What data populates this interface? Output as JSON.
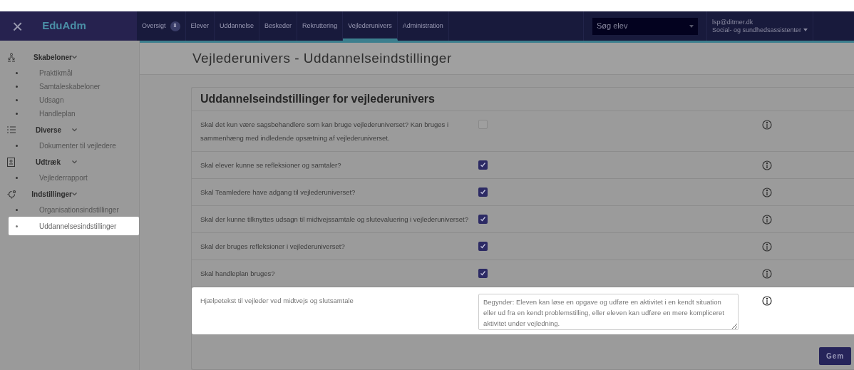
{
  "app": {
    "title": "EduAdm",
    "close_glyph": "×"
  },
  "nav_tabs": [
    {
      "label": "Oversigt",
      "badge": "8",
      "selected": false
    },
    {
      "label": "Elever",
      "selected": false
    },
    {
      "label": "Uddannelse",
      "selected": false
    },
    {
      "label": "Beskeder",
      "selected": false
    },
    {
      "label": "Rekruttering",
      "selected": false
    },
    {
      "label": "Vejlederunivers",
      "selected": true
    },
    {
      "label": "Administration",
      "selected": false
    }
  ],
  "search": {
    "placeholder": "Søg elev"
  },
  "user": {
    "email": "lsp@ditmer.dk",
    "role": "Social- og sundhedsassistenter"
  },
  "sidebar": {
    "groups": [
      {
        "label": "Skabeloner",
        "expanded": true,
        "items": [
          {
            "label": "Praktikmål",
            "selected": false
          },
          {
            "label": "Samtaleskabeloner",
            "selected": false
          },
          {
            "label": "Udsagn",
            "selected": false
          },
          {
            "label": "Handleplan",
            "selected": false
          }
        ]
      },
      {
        "label": "Diverse",
        "expanded": true,
        "items": [
          {
            "label": "Dokumenter til vejledere",
            "selected": false
          }
        ]
      },
      {
        "label": "Udtræk",
        "expanded": true,
        "items": [
          {
            "label": "Vejlederrapport",
            "selected": false
          }
        ]
      },
      {
        "label": "Indstillinger",
        "expanded": true,
        "items": [
          {
            "label": "Organisationsindstillinger",
            "selected": false
          },
          {
            "label": "Uddannelsesindstillinger",
            "selected": true
          }
        ]
      }
    ]
  },
  "page_title": "Vejlederunivers - Uddannelseindstillinger",
  "card": {
    "title": "Uddannelseindstillinger for vejlederunivers",
    "rows": [
      {
        "kind": "checkbox",
        "label": "Skal det kun være sagsbehandlere som kan bruge vejlederuniverset? Kan bruges i sammenhæng med indledende opsætning af vejlederuniverset.",
        "checked": false,
        "highlighted": false
      },
      {
        "kind": "checkbox",
        "label": "Skal elever kunne se refleksioner og samtaler?",
        "checked": true,
        "highlighted": false
      },
      {
        "kind": "checkbox",
        "label": "Skal Teamledere have adgang til vejlederuniverset?",
        "checked": true,
        "highlighted": false
      },
      {
        "kind": "checkbox",
        "label": "Skal der kunne tilknyttes udsagn til midtvejssamtale og slutevaluering i vejlederuniverset?",
        "checked": true,
        "highlighted": false
      },
      {
        "kind": "checkbox",
        "label": "Skal der bruges refleksioner i vejlederuniverset?",
        "checked": true,
        "highlighted": false
      },
      {
        "kind": "checkbox",
        "label": "Skal handleplan bruges?",
        "checked": true,
        "highlighted": false
      },
      {
        "kind": "textarea",
        "label": "Hjælpetekst til vejleder ved midtvejs og slutsamtale",
        "value": "Begynder: Eleven kan løse en opgave og udføre en aktivitet i en kendt situation eller ud fra en kendt problemstilling, eller eleven kan udføre en mere kompliceret aktivitet under vejledning.",
        "highlighted": true
      }
    ]
  },
  "save_button": "Gem"
}
